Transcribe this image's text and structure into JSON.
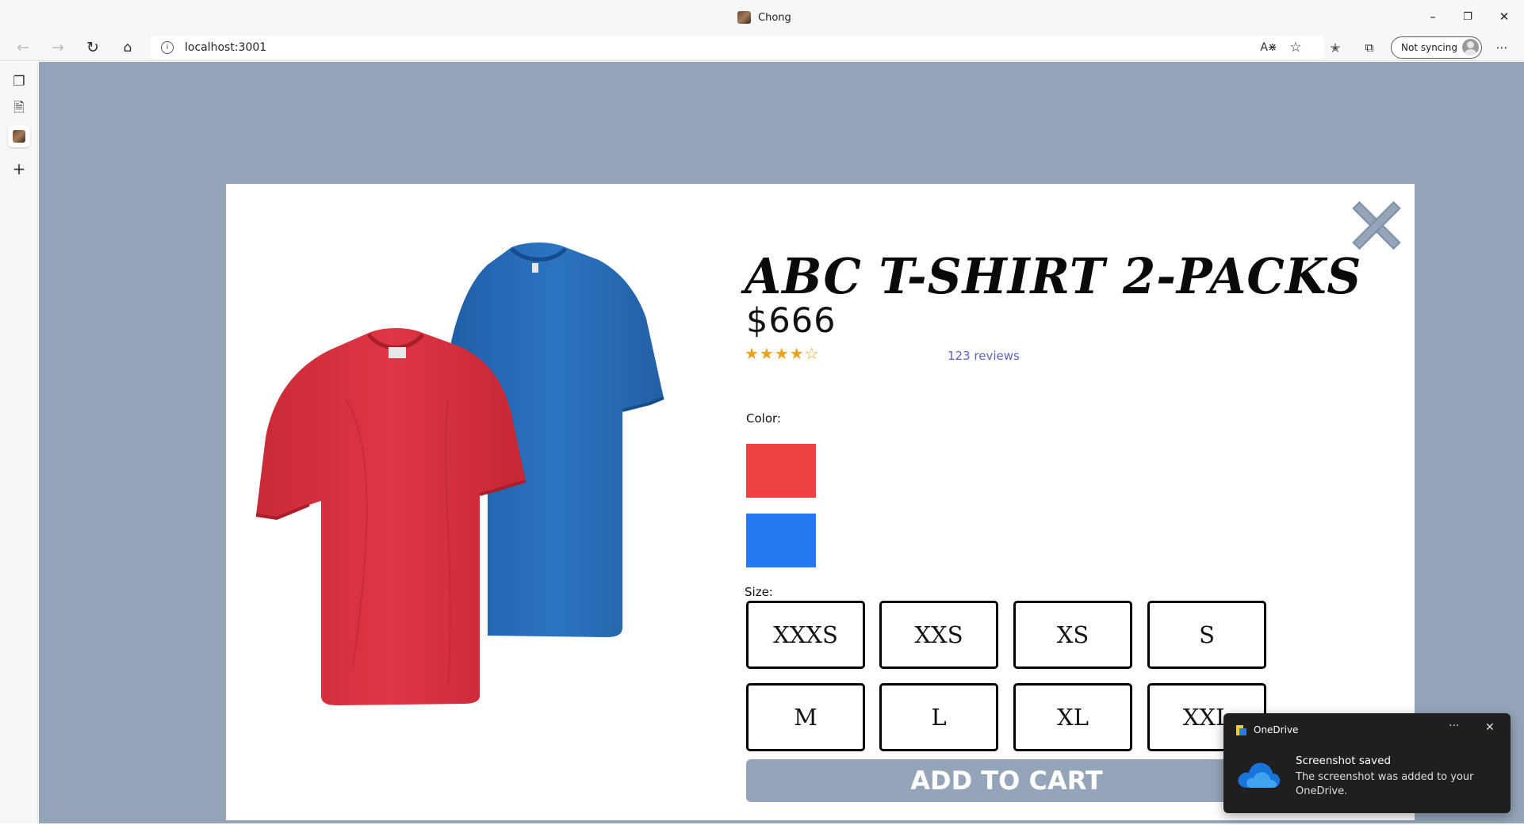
{
  "browser": {
    "window_title": "Chong",
    "address": "localhost:3001",
    "sync_label": "Not syncing",
    "icons": [
      "back-icon",
      "forward-icon",
      "refresh-icon",
      "home-icon",
      "info-icon",
      "read-aloud-icon",
      "add-favorite-icon",
      "favorites-icon",
      "collections-icon",
      "more-icon"
    ]
  },
  "product": {
    "title": "ABC T-SHIRT 2-PACKS",
    "price": "$666",
    "rating_text": "★★★★☆",
    "rating": 4,
    "rating_max": 5,
    "reviews": "123 reviews",
    "color_label": "Color:",
    "colors": [
      "#ee4242",
      "#2677f2"
    ],
    "size_label": "Size:",
    "sizes": [
      "XXXS",
      "XXS",
      "XS",
      "S",
      "M",
      "L",
      "XL",
      "XXL"
    ],
    "add_to_cart": "ADD TO CART"
  },
  "toast": {
    "app": "OneDrive",
    "more": "···",
    "close": "✕",
    "title": "Screenshot saved",
    "body": "The screenshot was added to your OneDrive."
  }
}
